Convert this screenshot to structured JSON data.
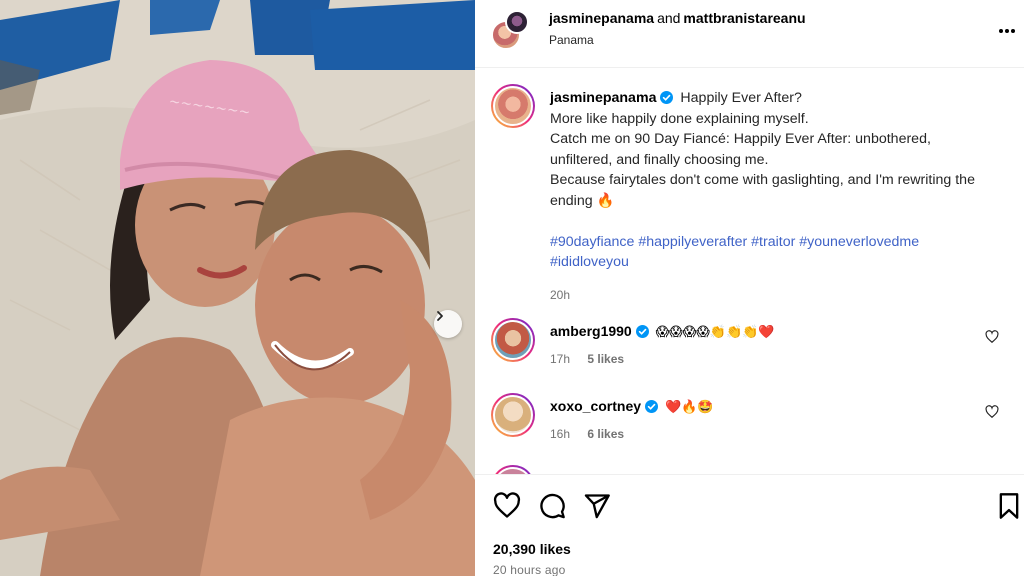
{
  "post": {
    "header": {
      "user1": "jasminepanama",
      "conj": "and",
      "user2": "mattbranistareanu",
      "location": "Panama",
      "more_icon": "more-horizontal-icon"
    },
    "caption": {
      "username": "jasminepanama",
      "lines": [
        "Happily Ever After?",
        "More like happily done explaining myself.",
        "Catch me on 90 Day Fiancé: Happily Ever After: unbothered, unfiltered, and finally choosing me.",
        "Because fairytales don't come with gaslighting, and I'm rewriting the ending 🔥"
      ],
      "hashtags": [
        "#90dayfiance",
        "#happilyeverafter",
        "#traitor",
        "#youneverlovedme",
        "#ididloveyou"
      ],
      "time": "20h"
    },
    "comments": [
      {
        "username": "amberg1990",
        "text": "😱😱😱😱👏👏👏❤️",
        "time": "17h",
        "likes": "5 likes"
      },
      {
        "username": "xoxo_cortney",
        "text": "❤️🔥🤩",
        "time": "16h",
        "likes": "6 likes"
      }
    ],
    "actions": {
      "like_icon": "heart-icon",
      "comment_icon": "comment-icon",
      "share_icon": "send-icon",
      "save_icon": "bookmark-icon"
    },
    "likes_total": "20,390 likes",
    "age": "20 hours ago"
  },
  "colors": {
    "hashtag": "#4063c7",
    "verified": "#0095f6",
    "meta": "#737373"
  }
}
